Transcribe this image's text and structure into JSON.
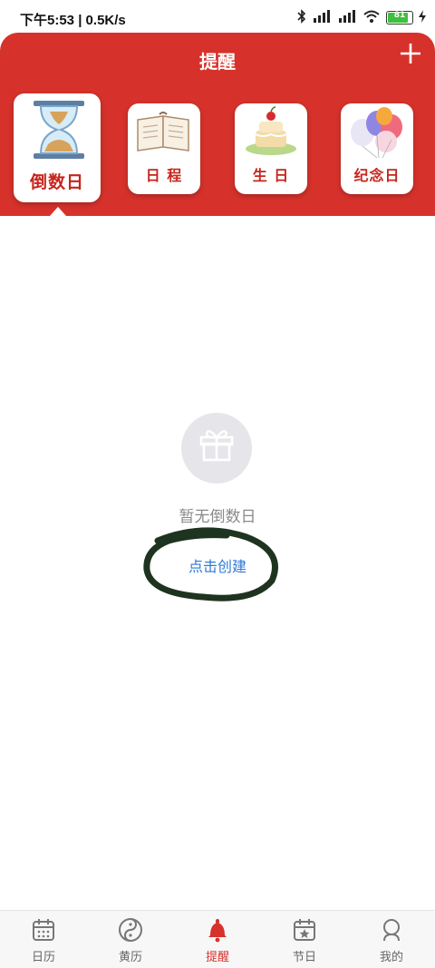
{
  "status_bar": {
    "time": "下午5:53 | 0.5K/s",
    "battery": "81",
    "icons": [
      "mute-icon",
      "alarm-icon",
      "app-icon",
      "bluetooth-icon",
      "signal-icon",
      "signal-icon",
      "wifi-icon",
      "battery-icon",
      "charging-icon"
    ]
  },
  "header": {
    "title": "提醒",
    "add_icon": "plus-icon",
    "accent_color": "#d6322b"
  },
  "tabs": [
    {
      "label": "倒数日",
      "icon": "hourglass-icon",
      "active": true
    },
    {
      "label": "日  程",
      "icon": "notebook-icon",
      "active": false
    },
    {
      "label": "生  日",
      "icon": "cake-icon",
      "active": false
    },
    {
      "label": "纪念日",
      "icon": "balloons-icon",
      "active": false
    }
  ],
  "empty_state": {
    "icon": "gift-icon",
    "text": "暂无倒数日",
    "action": "点击创建"
  },
  "bottom_nav": [
    {
      "label": "日历",
      "icon": "calendar-icon",
      "active": false
    },
    {
      "label": "黄历",
      "icon": "yin-yang-icon",
      "active": false
    },
    {
      "label": "提醒",
      "icon": "bell-icon",
      "active": true
    },
    {
      "label": "节日",
      "icon": "festival-calendar-icon",
      "active": false
    },
    {
      "label": "我的",
      "icon": "user-icon",
      "active": false
    }
  ]
}
